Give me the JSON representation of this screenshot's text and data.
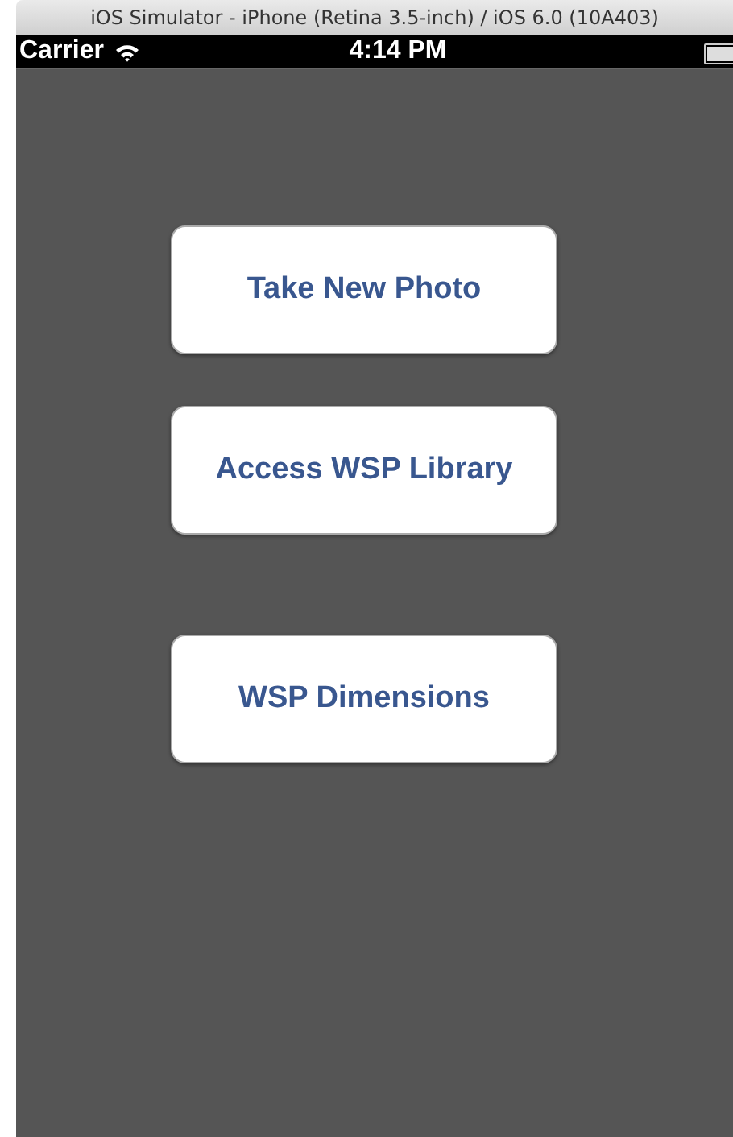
{
  "window": {
    "title": "iOS Simulator - iPhone (Retina 3.5-inch) / iOS 6.0 (10A403)"
  },
  "status_bar": {
    "carrier": "Carrier",
    "time": "4:14 PM"
  },
  "buttons": [
    {
      "label": "Take New Photo"
    },
    {
      "label": "Access WSP Library"
    },
    {
      "label": "WSP Dimensions"
    }
  ]
}
